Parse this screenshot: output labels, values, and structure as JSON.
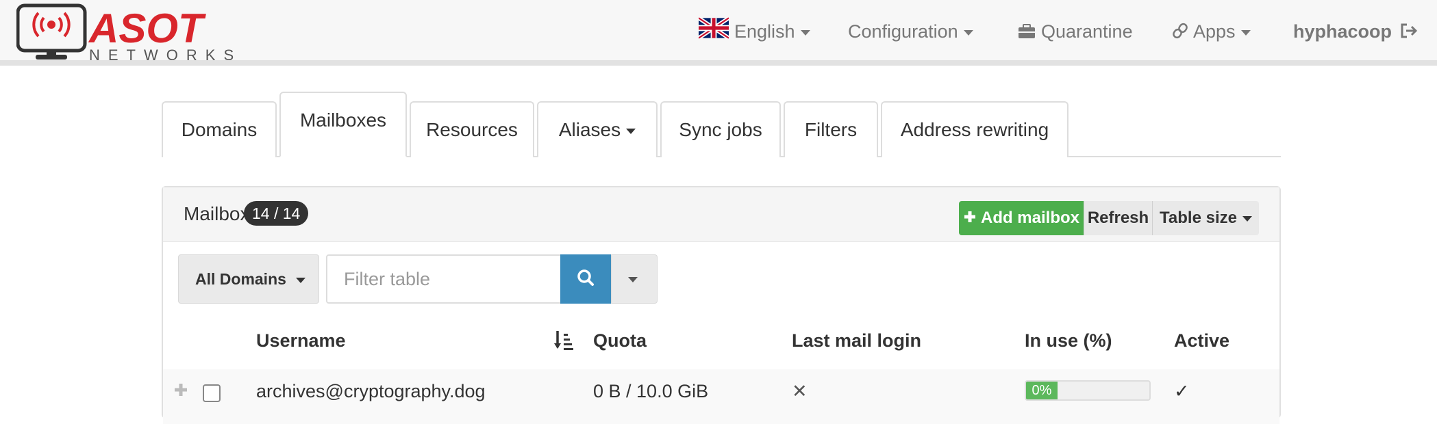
{
  "navbar": {
    "logo": {
      "brand": "ASOT",
      "sub": "NETWORKS"
    },
    "language": "English",
    "configuration": "Configuration",
    "quarantine": "Quarantine",
    "apps": "Apps",
    "user": "hyphacoop"
  },
  "tabs": [
    {
      "label": "Domains"
    },
    {
      "label": "Mailboxes",
      "active": true
    },
    {
      "label": "Resources"
    },
    {
      "label": "Aliases"
    },
    {
      "label": "Sync jobs"
    },
    {
      "label": "Filters"
    },
    {
      "label": "Address rewriting"
    }
  ],
  "panel": {
    "title": "Mailboxes",
    "count_badge": "14 / 14",
    "add_button": "Add mailbox",
    "refresh_button": "Refresh",
    "table_size_button": "Table size"
  },
  "filter": {
    "domain_select": "All Domains",
    "placeholder": "Filter table"
  },
  "table": {
    "columns": [
      "Username",
      "Quota",
      "Last mail login",
      "In use (%)",
      "Active"
    ],
    "rows": [
      {
        "username": "archives@cryptography.dog",
        "quota": "0 B / 10.0 GiB",
        "last_login": "✕",
        "in_use": "0%",
        "in_use_value": 0,
        "active": "✓"
      }
    ]
  },
  "colors": {
    "brand_red": "#d9262c",
    "add_green": "#4cae4c",
    "search_blue": "#3b8cbd",
    "badge_dark": "#333333"
  }
}
